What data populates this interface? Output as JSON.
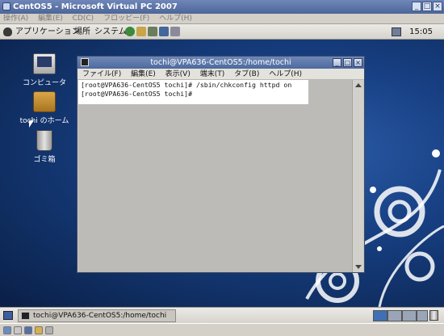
{
  "host_window": {
    "title": "CentOS5 - Microsoft Virtual PC 2007",
    "menu": [
      "操作(A)",
      "編集(E)",
      "CD(C)",
      "フロッピー(F)",
      "ヘルプ(H)"
    ]
  },
  "top_panel": {
    "menus": [
      "アプリケーション",
      "場所",
      "システム"
    ],
    "clock": "15:05"
  },
  "desktop_icons": [
    {
      "label": "コンピュータ"
    },
    {
      "label": "tochi のホーム"
    },
    {
      "label": "ゴミ箱"
    }
  ],
  "terminal": {
    "title": "tochi@VPA636-CentOS5:/home/tochi",
    "menu": [
      "ファイル(F)",
      "編集(E)",
      "表示(V)",
      "端末(T)",
      "タブ(B)",
      "ヘルプ(H)"
    ],
    "lines": [
      "[root@VPA636-CentOS5 tochi]# /sbin/chkconfig httpd on",
      "[root@VPA636-CentOS5 tochi]#"
    ]
  },
  "taskbar": {
    "task_label": "tochi@VPA636-CentOS5:/home/tochi"
  }
}
